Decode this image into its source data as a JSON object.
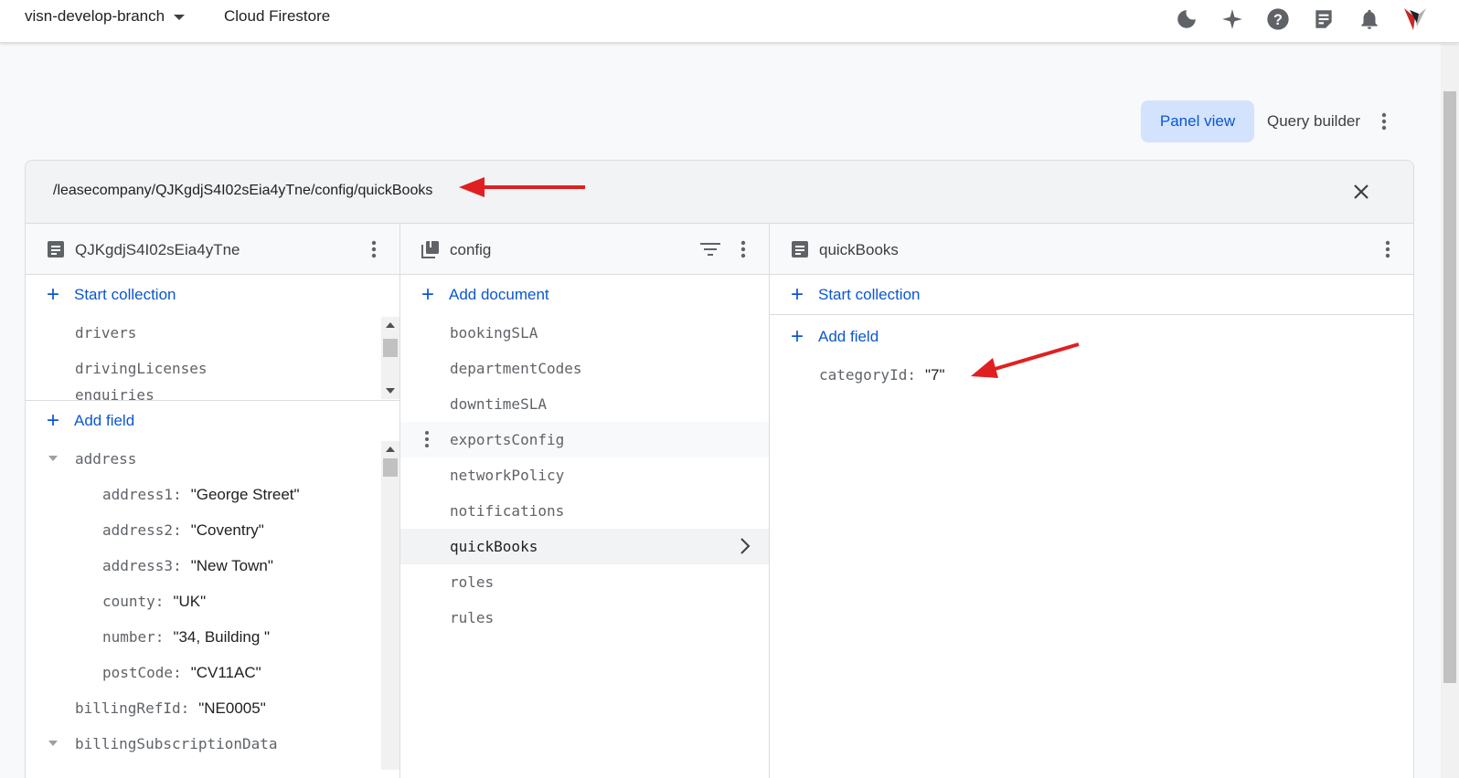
{
  "topbar": {
    "project_name": "visn-develop-branch",
    "product_name": "Cloud Firestore",
    "icons": [
      "dark-mode-icon",
      "sparkle-icon",
      "help-icon",
      "notes-icon",
      "notifications-icon",
      "avatar"
    ]
  },
  "view_toggle": {
    "panel_view": "Panel view",
    "query_builder": "Query builder"
  },
  "path": "/leasecompany/QJKgdjS4I02sEia4yTne/config/quickBooks",
  "col1": {
    "title": "QJKgdjS4I02sEia4yTne",
    "start_collection": "Start collection",
    "collections": [
      "drivers",
      "drivingLicenses",
      "enquiries"
    ],
    "add_field": "Add field",
    "fields": {
      "address_key": "address",
      "address1_key": "address1:",
      "address1_val": "\"George Street\"",
      "address2_key": "address2:",
      "address2_val": "\"Coventry\"",
      "address3_key": "address3:",
      "address3_val": "\"New Town\"",
      "county_key": "county:",
      "county_val": "\"UK\"",
      "number_key": "number:",
      "number_val": "\"34, Building \"",
      "postcode_key": "postCode:",
      "postcode_val": "\"CV11AC\"",
      "billing_key": "billingRefId:",
      "billing_val": "\"NE0005\"",
      "billing_sub_key": "billingSubscriptionData"
    }
  },
  "col2": {
    "title": "config",
    "add_document": "Add document",
    "documents": [
      "bookingSLA",
      "departmentCodes",
      "downtimeSLA",
      "exportsConfig",
      "networkPolicy",
      "notifications",
      "quickBooks",
      "roles",
      "rules"
    ]
  },
  "col3": {
    "title": "quickBooks",
    "start_collection": "Start collection",
    "add_field": "Add field",
    "field_key": "categoryId:",
    "field_val": "\"7\""
  },
  "colors": {
    "accent": "#0b57d0",
    "selected_button": "#d3e3fd",
    "annotation_arrow": "#e02020"
  }
}
